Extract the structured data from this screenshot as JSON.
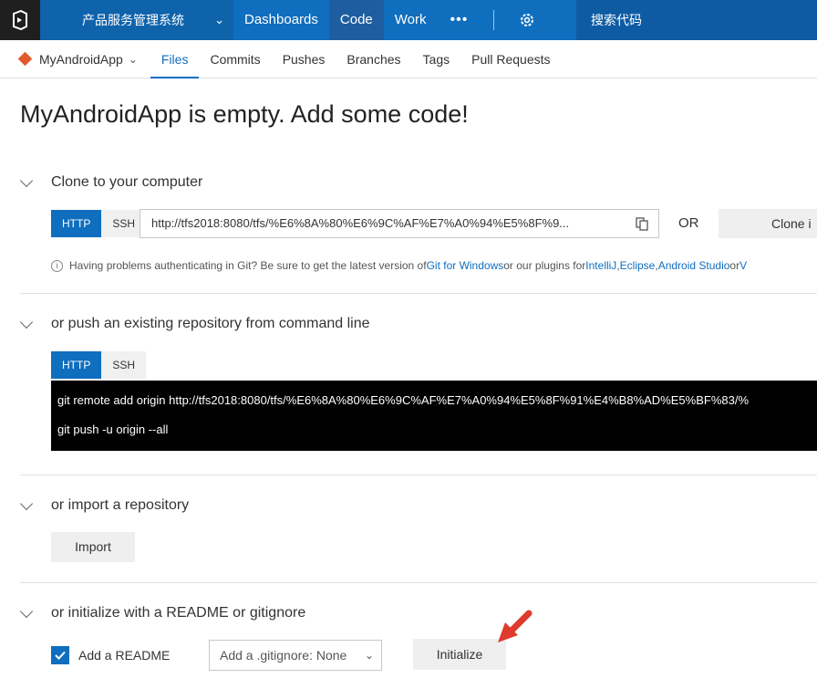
{
  "topbar": {
    "project_name": "产品服务管理系统",
    "nav": [
      "Dashboards",
      "Code",
      "Work"
    ],
    "active_nav": "Code",
    "more": "•••",
    "search_placeholder": "搜索代码"
  },
  "subnav": {
    "repo_name": "MyAndroidApp",
    "tabs": [
      "Files",
      "Commits",
      "Pushes",
      "Branches",
      "Tags",
      "Pull Requests"
    ],
    "active_tab": "Files"
  },
  "page": {
    "title": "MyAndroidApp is empty. Add some code!"
  },
  "clone": {
    "heading": "Clone to your computer",
    "protocols": [
      "HTTP",
      "SSH"
    ],
    "url": "http://tfs2018:8080/tfs/%E6%8A%80%E6%9C%AF%E7%A0%94%E5%8F%9...",
    "or_label": "OR",
    "clone_button": "Clone i",
    "hint_prefix": "Having problems authenticating in Git? Be sure to get the latest version of ",
    "hint_link1": "Git for Windows",
    "hint_mid": " or our plugins for ",
    "hint_link2": "IntelliJ",
    "hint_comma1": ", ",
    "hint_link3": "Eclipse",
    "hint_comma2": ", ",
    "hint_link4": "Android Studio",
    "hint_suffix": " or ",
    "hint_link5": "V"
  },
  "push": {
    "heading": "or push an existing repository from command line",
    "protocols": [
      "HTTP",
      "SSH"
    ],
    "command1": "git remote add origin http://tfs2018:8080/tfs/%E6%8A%80%E6%9C%AF%E7%A0%94%E5%8F%91%E4%B8%AD%E5%BF%83/%",
    "command2": "git push -u origin --all"
  },
  "import": {
    "heading": "or import a repository",
    "button": "Import"
  },
  "initialize": {
    "heading": "or initialize with a README or gitignore",
    "readme_label": "Add a README",
    "readme_checked": true,
    "gitignore_select": "Add a .gitignore: None",
    "button": "Initialize"
  },
  "colors": {
    "accent": "#106ebe",
    "topbar": "#106ebe",
    "arrow": "#e03a2e"
  }
}
